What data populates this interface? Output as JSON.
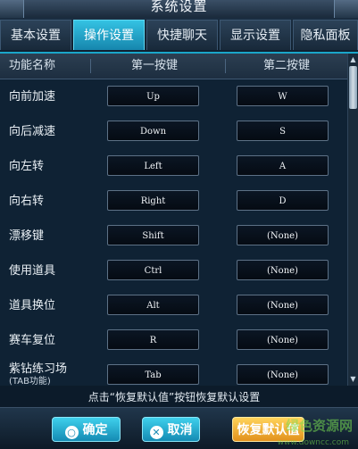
{
  "window": {
    "title": "系统设置"
  },
  "tabs": [
    {
      "label": "基本设置"
    },
    {
      "label": "操作设置"
    },
    {
      "label": "快捷聊天"
    },
    {
      "label": "显示设置"
    },
    {
      "label": "隐私面板"
    }
  ],
  "active_tab": "操作设置",
  "table": {
    "headers": {
      "name": "功能名称",
      "primary": "第一按键",
      "secondary": "第二按键"
    },
    "rows": [
      {
        "name": "向前加速",
        "sub": "",
        "primary": "Up",
        "secondary": "W"
      },
      {
        "name": "向后减速",
        "sub": "",
        "primary": "Down",
        "secondary": "S"
      },
      {
        "name": "向左转",
        "sub": "",
        "primary": "Left",
        "secondary": "A"
      },
      {
        "name": "向右转",
        "sub": "",
        "primary": "Right",
        "secondary": "D"
      },
      {
        "name": "漂移键",
        "sub": "",
        "primary": "Shift",
        "secondary": "(None)"
      },
      {
        "name": "使用道具",
        "sub": "",
        "primary": "Ctrl",
        "secondary": "(None)"
      },
      {
        "name": "道具换位",
        "sub": "",
        "primary": "Alt",
        "secondary": "(None)"
      },
      {
        "name": "赛车复位",
        "sub": "",
        "primary": "R",
        "secondary": "(None)"
      },
      {
        "name": "紫钻练习场",
        "sub": "(TAB功能)",
        "primary": "Tab",
        "secondary": "(None)"
      }
    ]
  },
  "hint": "点击“恢复默认值”按钮恢复默认设置",
  "buttons": {
    "ok": "确定",
    "cancel": "取消",
    "reset": "恢复默认值"
  },
  "watermark": {
    "text": "绿色资源网",
    "url": "www.downcc.com"
  },
  "colors": {
    "accent": "#1aa6c9",
    "reset_button": "#f0a531",
    "background": "#0c1b2a"
  }
}
